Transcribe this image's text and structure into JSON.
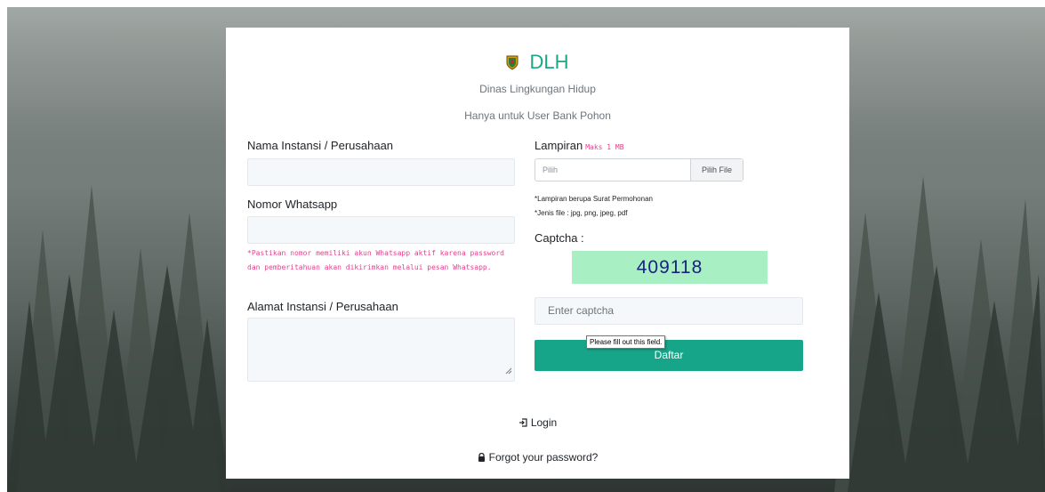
{
  "brand": {
    "name": "DLH",
    "subtitle": "Dinas Lingkungan Hidup",
    "note": "Hanya untuk User Bank Pohon"
  },
  "form": {
    "company_name": {
      "label": "Nama Instansi / Perusahaan",
      "value": ""
    },
    "whatsapp": {
      "label": "Nomor Whatsapp",
      "value": "",
      "warning": "*Pastikan nomor memiliki akun Whatsapp aktif karena password dan pemberitahuan akan dikirimkan melalui pesan Whatsapp."
    },
    "address": {
      "label": "Alamat Instansi / Perusahaan",
      "value": ""
    },
    "attachment": {
      "label": "Lampiran",
      "max_size": "Maks 1 MB",
      "placeholder": "Pilih",
      "button": "Pilih File",
      "note1": "*Lampiran berupa Surat Permohonan",
      "note2": "*Jenis file : jpg, png, jpeg, pdf"
    },
    "captcha": {
      "label": "Captcha :",
      "code": "409118",
      "placeholder": "Enter captcha"
    },
    "submit_label": "Daftar",
    "validation_tooltip": "Please fill out this field."
  },
  "links": {
    "login": "Login",
    "forgot": "Forgot your password?"
  },
  "colors": {
    "brand": "#1aa686",
    "button": "#17a589",
    "captcha_bg": "#a9efc4",
    "warning": "#e83e8c"
  },
  "icons": {
    "brand": "shield-logo-icon",
    "login": "sign-in-icon",
    "forgot": "lock-icon"
  }
}
